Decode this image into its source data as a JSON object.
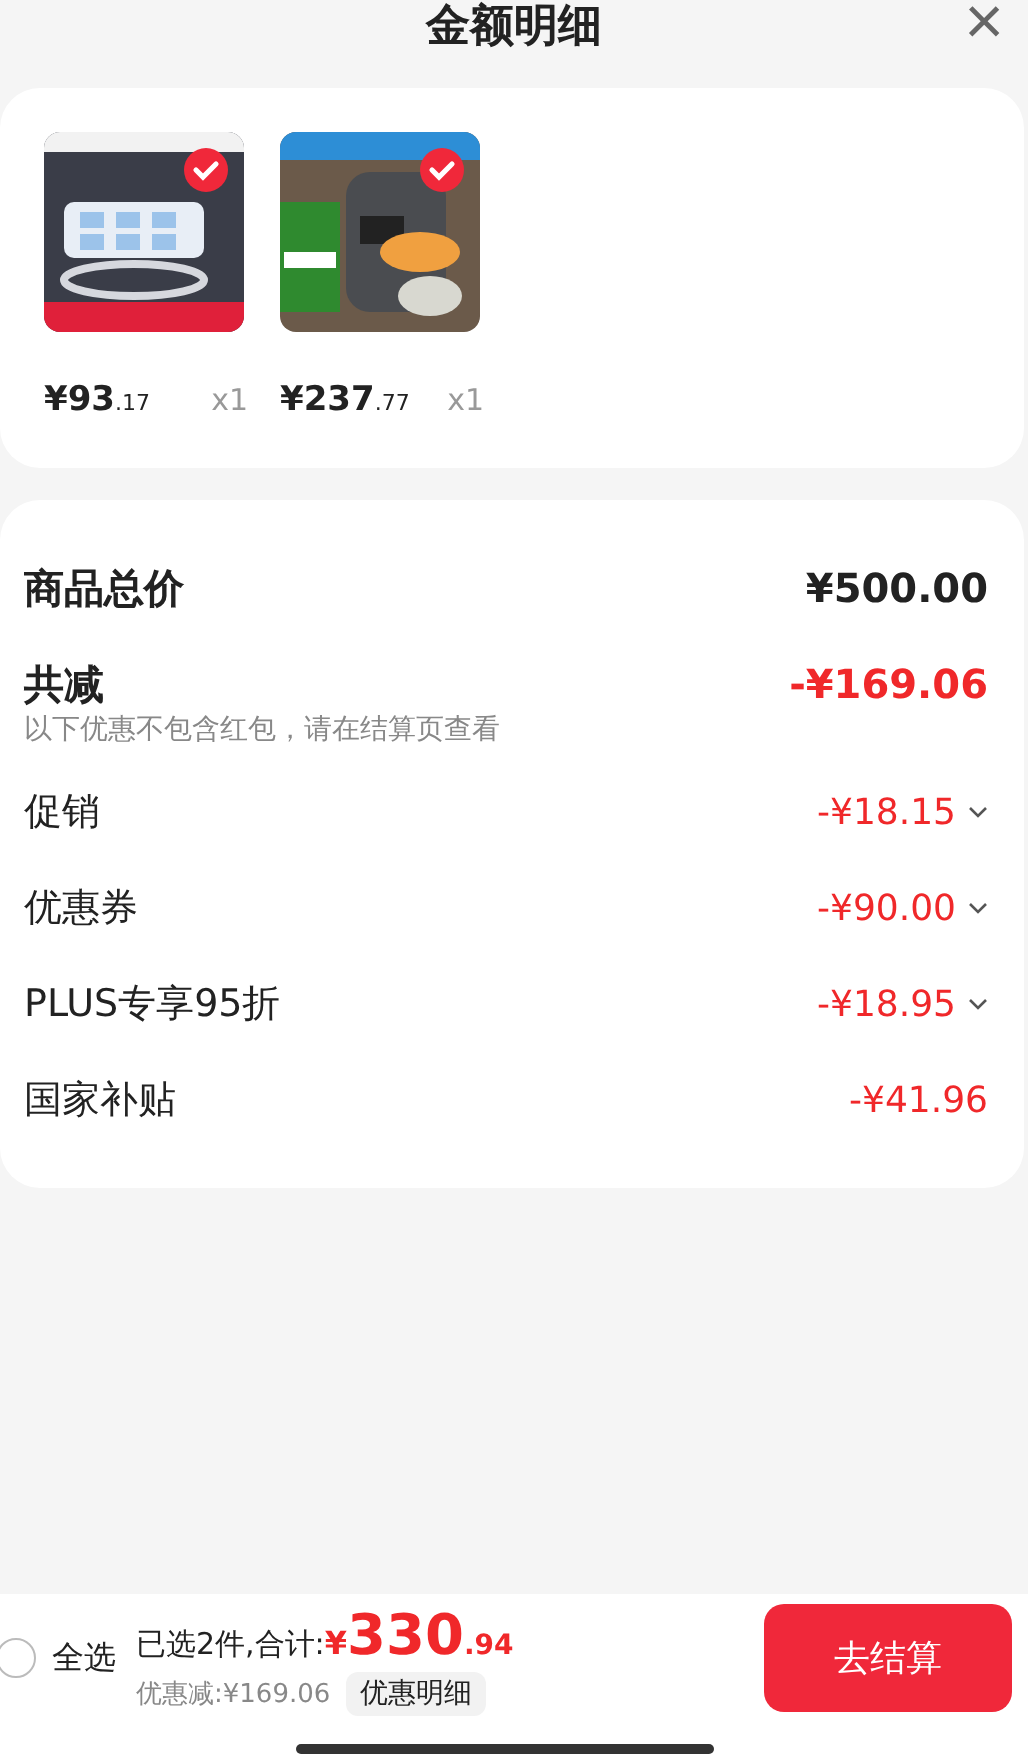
{
  "header": {
    "title": "金额明细",
    "close": "×"
  },
  "products": [
    {
      "selected": true,
      "price_main": "¥93",
      "price_cents": ".17",
      "quantity": "x1"
    },
    {
      "selected": true,
      "price_main": "¥237",
      "price_cents": ".77",
      "quantity": "x1"
    }
  ],
  "summary": [
    {
      "kind": "total",
      "label": "商品总价",
      "amount": "¥500.00"
    },
    {
      "kind": "reduction",
      "label": "共减",
      "amount": "-¥169.06",
      "note": "以下优惠不包含红包，请在结算页查看"
    },
    {
      "kind": "item",
      "label": "促销",
      "amount": "-¥18.15",
      "expandable": true
    },
    {
      "kind": "item",
      "label": "优惠券",
      "amount": "-¥90.00",
      "expandable": true
    },
    {
      "kind": "item",
      "label": "PLUS专享95折",
      "amount": "-¥18.95",
      "expandable": true
    },
    {
      "kind": "item",
      "label": "国家补贴",
      "amount": "-¥41.96",
      "expandable": false
    }
  ],
  "footer": {
    "select_all": {
      "label": "全选",
      "checked": false
    },
    "selected_text": "已选2件,合计:",
    "total_currency": "¥",
    "total_main": "330",
    "total_cents": ".94",
    "discount": "优惠减:¥169.06",
    "details_button": "优惠明细",
    "checkout_button": "去结算"
  }
}
